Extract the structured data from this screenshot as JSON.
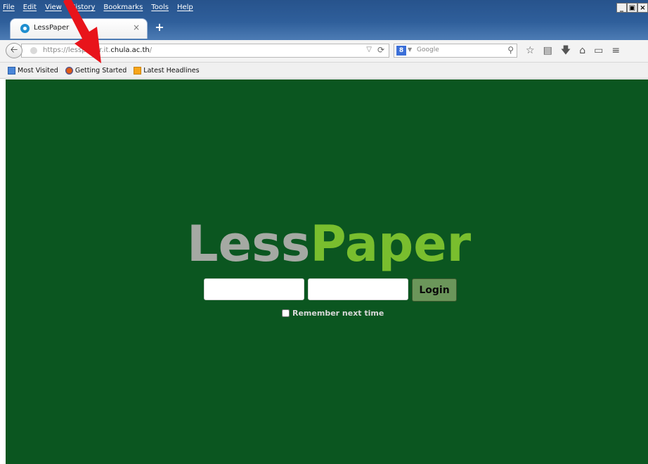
{
  "browser": {
    "menu": [
      "File",
      "Edit",
      "View",
      "History",
      "Bookmarks",
      "Tools",
      "Help"
    ],
    "window_buttons": [
      "_",
      "×"
    ],
    "tab": {
      "title": "LessPaper",
      "close": "×"
    },
    "new_tab": "+",
    "url": {
      "prefix": "https://lesspaper.it.",
      "domain": "chula.ac.th",
      "suffix": "/"
    },
    "search": {
      "placeholder": "Google",
      "engine_icon": "8"
    },
    "bookmarks": [
      "Most Visited",
      "Getting Started",
      "Latest Headlines"
    ]
  },
  "page": {
    "logo_less": "Less",
    "logo_paper": "Paper",
    "login_label": "Login",
    "remember_label": "Remember next time"
  },
  "colors": {
    "page_background": "#0b5620",
    "logo_less": "#a5a9a3",
    "logo_paper": "#79be2e",
    "login_button": "#6b965a",
    "annotation_arrow": "#e8141b"
  },
  "annotation": {
    "type": "red-arrow-icon",
    "points_to": "url-bar"
  }
}
